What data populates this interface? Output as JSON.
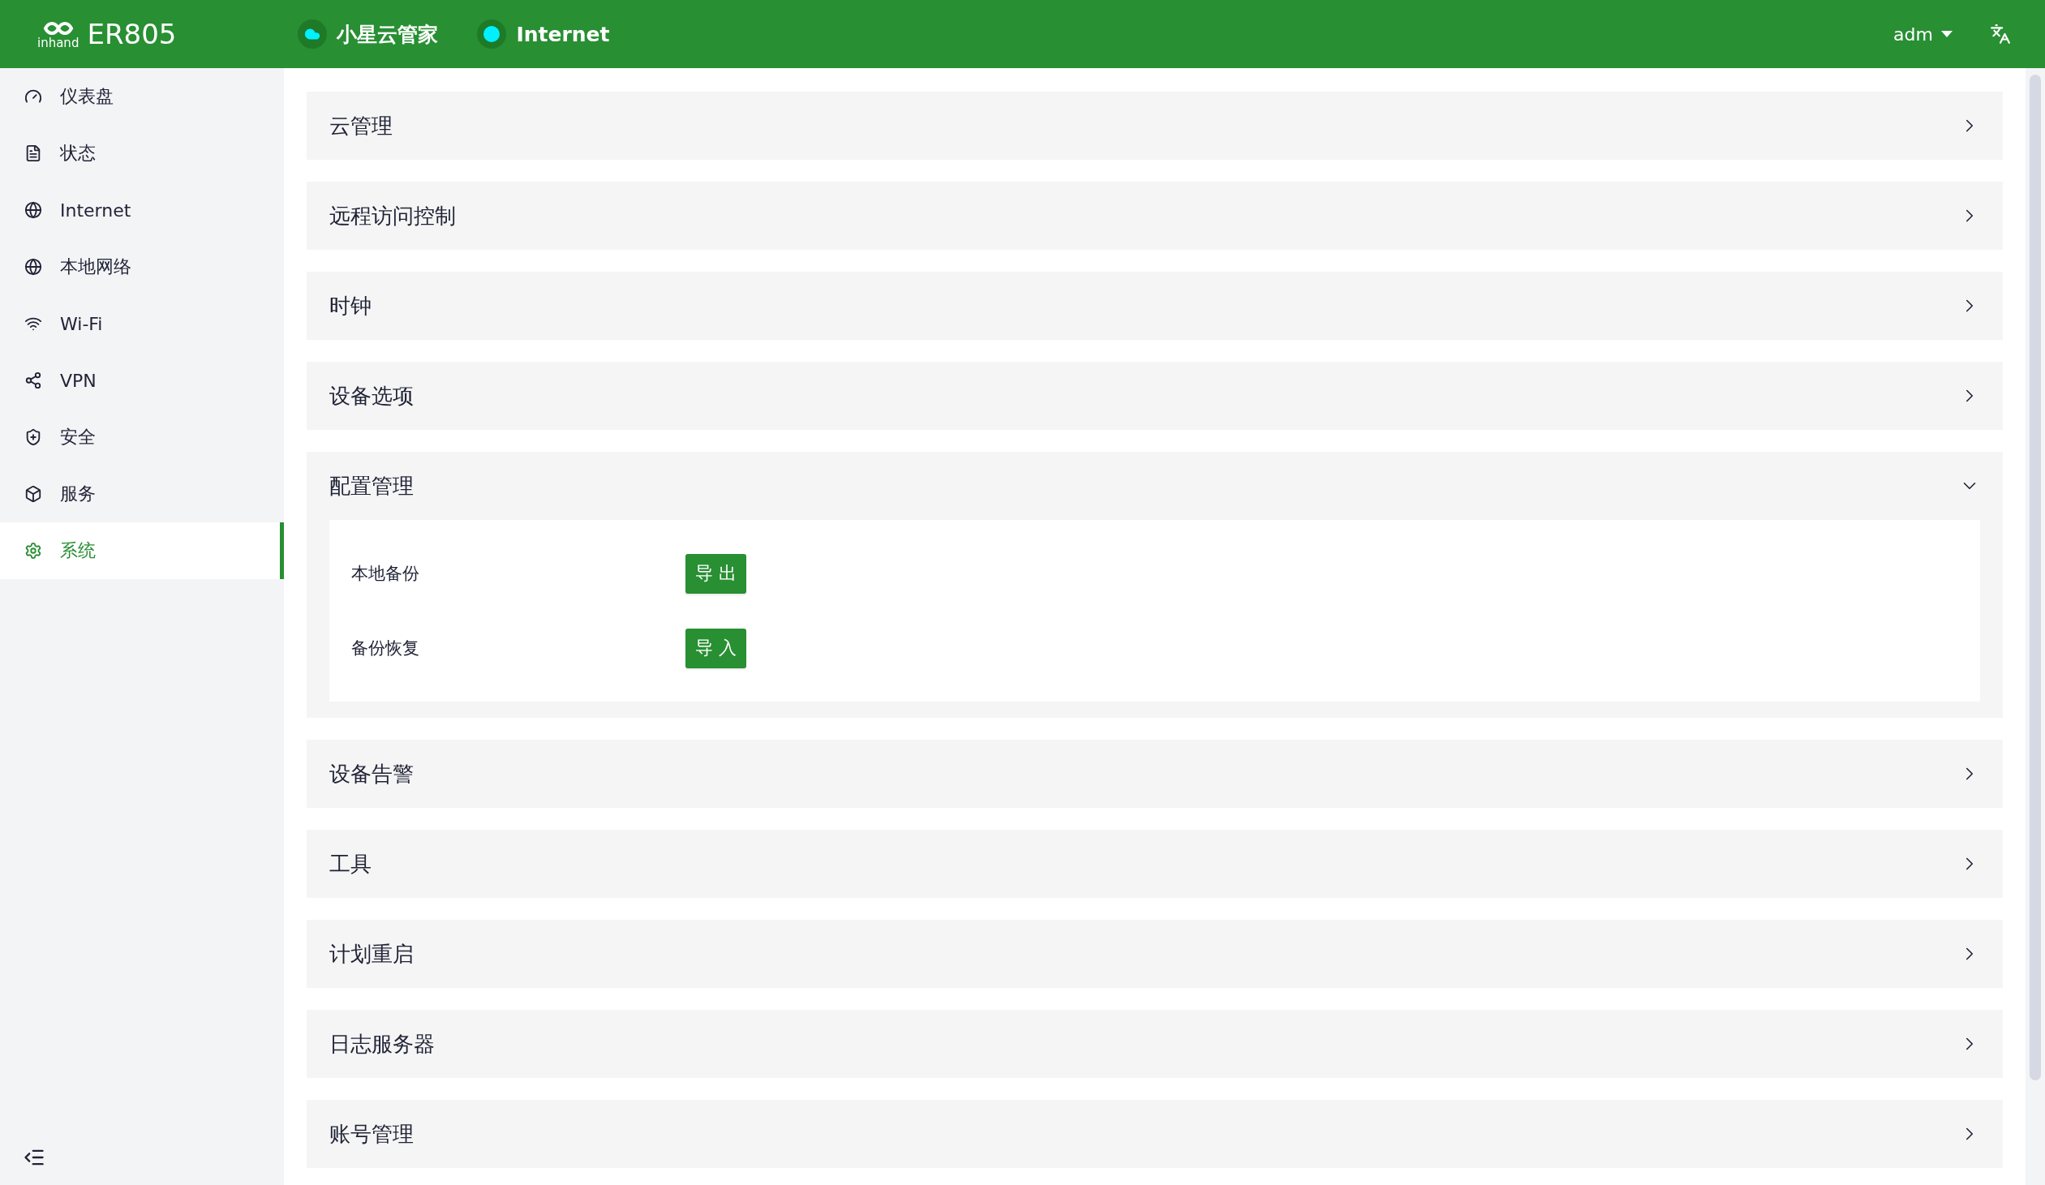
{
  "header": {
    "logo_text": "inhand",
    "product": "ER805",
    "status": [
      {
        "label": "小星云管家",
        "online": true
      },
      {
        "label": "Internet",
        "online": true
      }
    ],
    "user": "adm"
  },
  "sidebar": {
    "items": [
      {
        "label": "仪表盘",
        "selected": false
      },
      {
        "label": "状态",
        "selected": false
      },
      {
        "label": "Internet",
        "selected": false
      },
      {
        "label": "本地网络",
        "selected": false
      },
      {
        "label": "Wi-Fi",
        "selected": false
      },
      {
        "label": "VPN",
        "selected": false
      },
      {
        "label": "安全",
        "selected": false
      },
      {
        "label": "服务",
        "selected": false
      },
      {
        "label": "系统",
        "selected": true
      }
    ]
  },
  "panels": [
    {
      "title": "云管理",
      "expanded": false
    },
    {
      "title": "远程访问控制",
      "expanded": false
    },
    {
      "title": "时钟",
      "expanded": false
    },
    {
      "title": "设备选项",
      "expanded": false
    },
    {
      "title": "配置管理",
      "expanded": true,
      "rows": [
        {
          "label": "本地备份",
          "button": "导 出"
        },
        {
          "label": "备份恢复",
          "button": "导 入"
        }
      ]
    },
    {
      "title": "设备告警",
      "expanded": false
    },
    {
      "title": "工具",
      "expanded": false
    },
    {
      "title": "计划重启",
      "expanded": false
    },
    {
      "title": "日志服务器",
      "expanded": false
    },
    {
      "title": "账号管理",
      "expanded": false
    }
  ]
}
